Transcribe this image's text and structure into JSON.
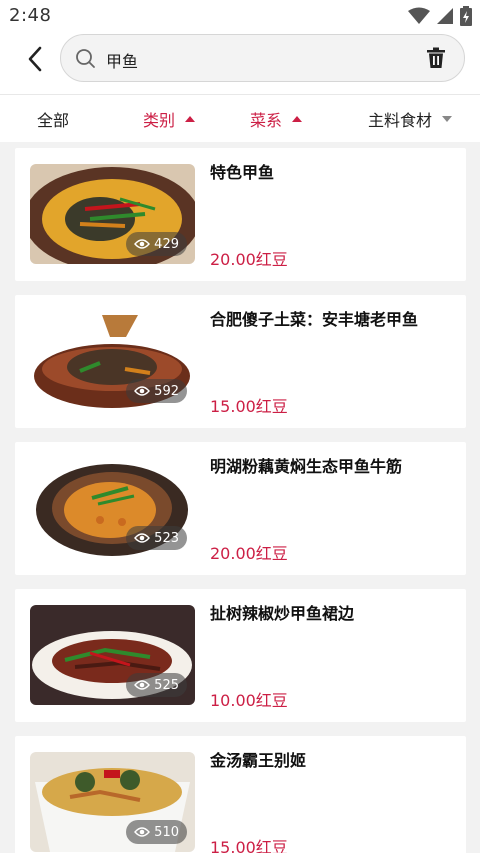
{
  "status": {
    "time": "2:48"
  },
  "search": {
    "query": "甲鱼"
  },
  "filters": [
    {
      "label": "全部",
      "state": "none"
    },
    {
      "label": "类别",
      "state": "active"
    },
    {
      "label": "菜系",
      "state": "active"
    },
    {
      "label": "主料食材",
      "state": "inactive"
    }
  ],
  "dishes": [
    {
      "title": "特色甲鱼",
      "price": "20.00红豆",
      "views": "429"
    },
    {
      "title": "合肥傻子土菜：安丰塘老甲鱼",
      "price": "15.00红豆",
      "views": "592"
    },
    {
      "title": "明湖粉藕黄焖生态甲鱼牛筋",
      "price": "20.00红豆",
      "views": "523"
    },
    {
      "title": "扯树辣椒炒甲鱼裙边",
      "price": "10.00红豆",
      "views": "525"
    },
    {
      "title": "金汤霸王别姬",
      "price": "15.00红豆",
      "views": "510"
    }
  ],
  "colors": {
    "accent": "#cc1f45"
  }
}
